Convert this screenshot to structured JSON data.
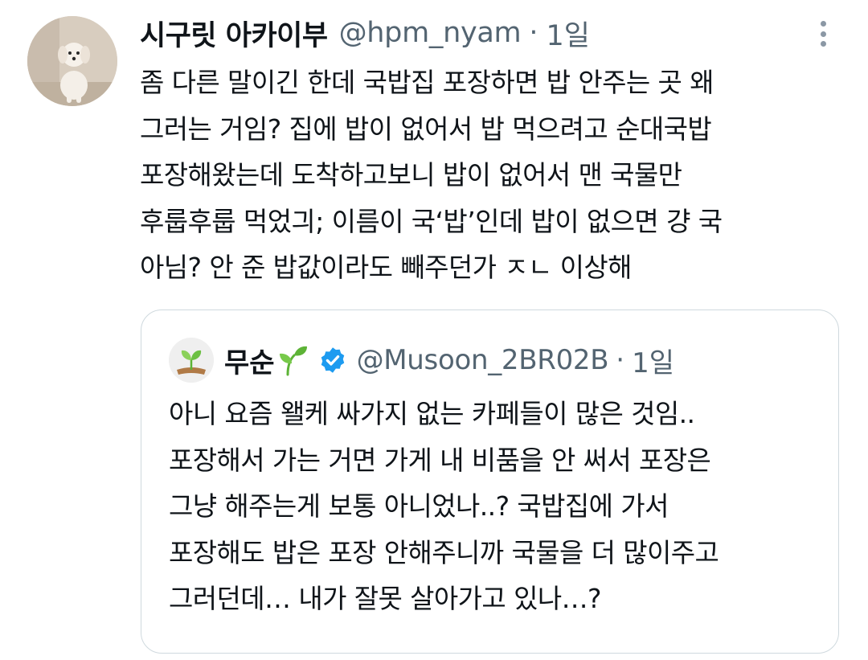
{
  "tweet": {
    "author_name": "시구릿 아카이부",
    "author_handle": "@hpm_nyam",
    "separator": "·",
    "time": "1일",
    "text_lines": [
      "좀 다른 말이긴 한데 국밥집 포장하면 밥 안주는 곳 왜",
      "그러는 거임? 집에 밥이 없어서 밥 먹으려고 순대국밥",
      "포장해왔는데 도착하고보니 밥이 없어서 맨 국물만",
      "후룹후룹 먹었긔; 이름이 국‘밥’인데 밥이 없으면 걍 국",
      "아님? 안 준 밥값이라도 빼주던가 ㅈㄴ 이상해"
    ],
    "more_icon": "more-vertical-icon"
  },
  "quoted_tweet": {
    "author_name": "무순",
    "name_emoji": "seedling-icon",
    "verified_icon": "verified-badge-icon",
    "author_handle": "@Musoon_2BR02B",
    "separator": "·",
    "time": "1일",
    "text_lines": [
      "아니 요즘 왤케 싸가지 없는 카페들이 많은 것임..",
      "포장해서 가는 거면 가게 내 비품을 안 써서 포장은",
      "그냥 해주는게 보통 아니었나..? 국밥집에 가서",
      "포장해도 밥은 포장 안해주니까 국물을 더 많이주고",
      "그러던데… 내가 잘못 살아가고 있나…?"
    ]
  },
  "colors": {
    "text_primary": "#0f1419",
    "text_secondary": "#536471",
    "border": "#cfd9de",
    "verified_blue": "#1d9bf0",
    "seedling_green": "#5db336"
  }
}
